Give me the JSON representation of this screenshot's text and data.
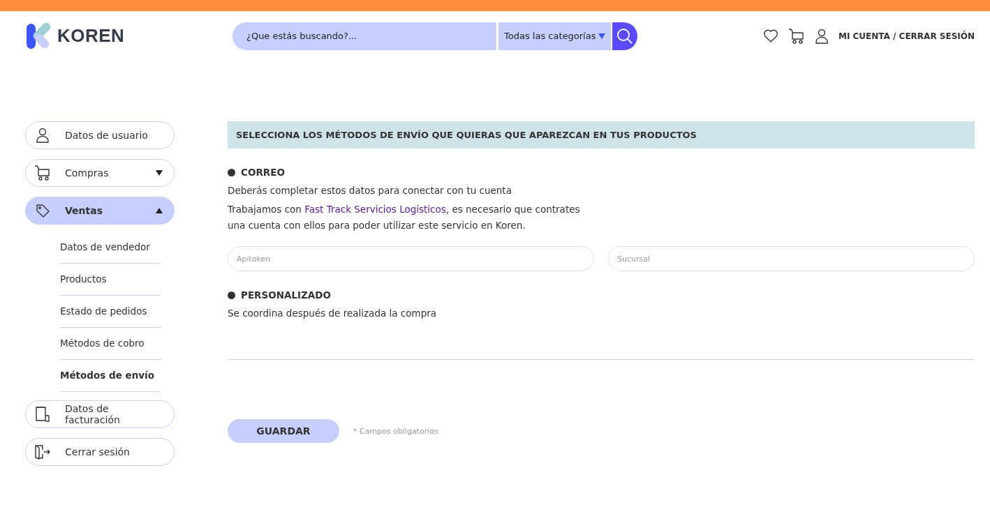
{
  "header": {
    "logo": "KOREN",
    "search": {
      "placeholder": "¿Que estás buscando?..."
    },
    "category": "Todas las categorías",
    "account": "MI CUENTA / CERRAR SESIÓN"
  },
  "sidebar": {
    "items": [
      {
        "label": "Datos de usuario",
        "selected": false
      },
      {
        "label": "Compras",
        "selected": false,
        "expanded": false
      },
      {
        "label": "Ventas",
        "selected": true,
        "expanded": true,
        "children": [
          {
            "label": "Datos de vendedor",
            "selected": false
          },
          {
            "label": "Productos",
            "selected": false
          },
          {
            "label": "Estado de pedidos",
            "selected": false
          },
          {
            "label": "Métodos de cobro",
            "selected": false
          },
          {
            "label": "Métodos de envío",
            "selected": true
          }
        ]
      },
      {
        "label": "Datos de facturación",
        "selected": false
      },
      {
        "label": "Cerrar sesión",
        "selected": false
      }
    ]
  },
  "section_title": "SELECCIONA LOS MÉTODOS DE ENVÍO QUE QUIERAS QUE APAREZCAN EN TUS PRODUCTOS",
  "methods": [
    {
      "title": "CORREO",
      "description": "Deberás completar estos datos para conectar con tu cuenta",
      "note_before": "Trabajamos con ",
      "note_link": "Fast Track Servicios Logísticos",
      "note_after": ", es necesario que contrates una cuenta con ellos para poder utilizar este servicio en Koren.",
      "fields": [
        {
          "placeholder": "Apitoken"
        },
        {
          "placeholder": "Sucursal"
        }
      ]
    },
    {
      "title": "PERSONALIZADO",
      "description": "Se coordina después de realizada la compra"
    }
  ],
  "save_button": "GUARDAR",
  "required_note": "* Campos obligatorios"
}
